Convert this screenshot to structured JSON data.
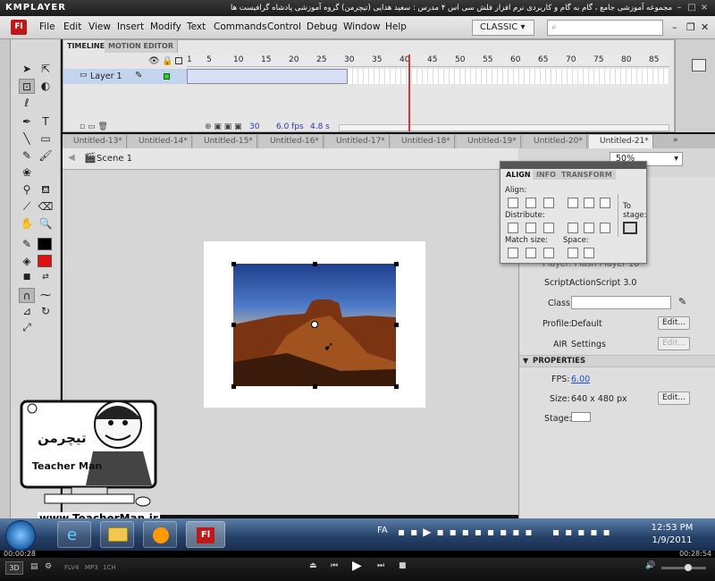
{
  "kmplayer": {
    "logo": "KMPLAYER",
    "caption": "مجموعه آموزشی جامع ، گام به گام و کاربردی نرم افزار فلش سی اس ۴ مدرس : سعید هدایی (تیچرمن) گروه آموزشی پادشاه گرافیست ها",
    "time_elapsed": "00:00:28",
    "time_total": "00:28:54",
    "badge_3d": "3D",
    "format_labels": [
      "FLV4",
      "MP3",
      "1CH"
    ]
  },
  "flash": {
    "logo": "Fl",
    "menu": [
      "File",
      "Edit",
      "View",
      "Insert",
      "Modify",
      "Text",
      "Commands",
      "Control",
      "Debug",
      "Window",
      "Help"
    ],
    "workspace": "CLASSIC",
    "timeline": {
      "tabs": [
        "TIMELINE",
        "MOTION EDITOR"
      ],
      "frame_numbers": [
        "1",
        "5",
        "10",
        "15",
        "20",
        "25",
        "30",
        "35",
        "40",
        "45",
        "50",
        "55",
        "60",
        "65",
        "70",
        "75",
        "80",
        "85"
      ],
      "layer_name": "Layer 1",
      "current_frame": "30",
      "fps": "6.0 fps",
      "time": "4.8 s"
    },
    "doc_tabs": [
      "Untitled-13*",
      "Untitled-14*",
      "Untitled-15*",
      "Untitled-16*",
      "Untitled-17*",
      "Untitled-18*",
      "Untitled-19*",
      "Untitled-20*",
      "Untitled-21*"
    ],
    "active_doc": "Untitled-21*",
    "scene": "Scene 1",
    "zoom": "50%",
    "align_panel": {
      "tabs": [
        "ALIGN",
        "INFO",
        "TRANSFORM"
      ],
      "align_label": "Align:",
      "distribute_label": "Distribute:",
      "match_size_label": "Match size:",
      "space_label": "Space:",
      "to_stage_label": "To stage:"
    },
    "properties": {
      "player": "Player: Flash Player 10",
      "script_label": "Script:",
      "script_value": "ActionScript 3.0",
      "class_label": "Class:",
      "profile_label": "Profile:",
      "profile_value": "Default",
      "air_label": "AIR",
      "air_value": "Settings",
      "edit_label": "Edit...",
      "section_title": "PROPERTIES",
      "fps_label": "FPS:",
      "fps_value": "6.00",
      "size_label": "Size:",
      "size_value": "640 x 480 px",
      "stage_label": "Stage:"
    }
  },
  "watermark": {
    "url": "www.TeacherMan.ir",
    "name": "Teacher Man",
    "logo_text": "تیچرمن"
  },
  "taskbar": {
    "lang": "FA",
    "time": "12:53 PM",
    "date": "1/9/2011",
    "active_app": "Fl"
  }
}
